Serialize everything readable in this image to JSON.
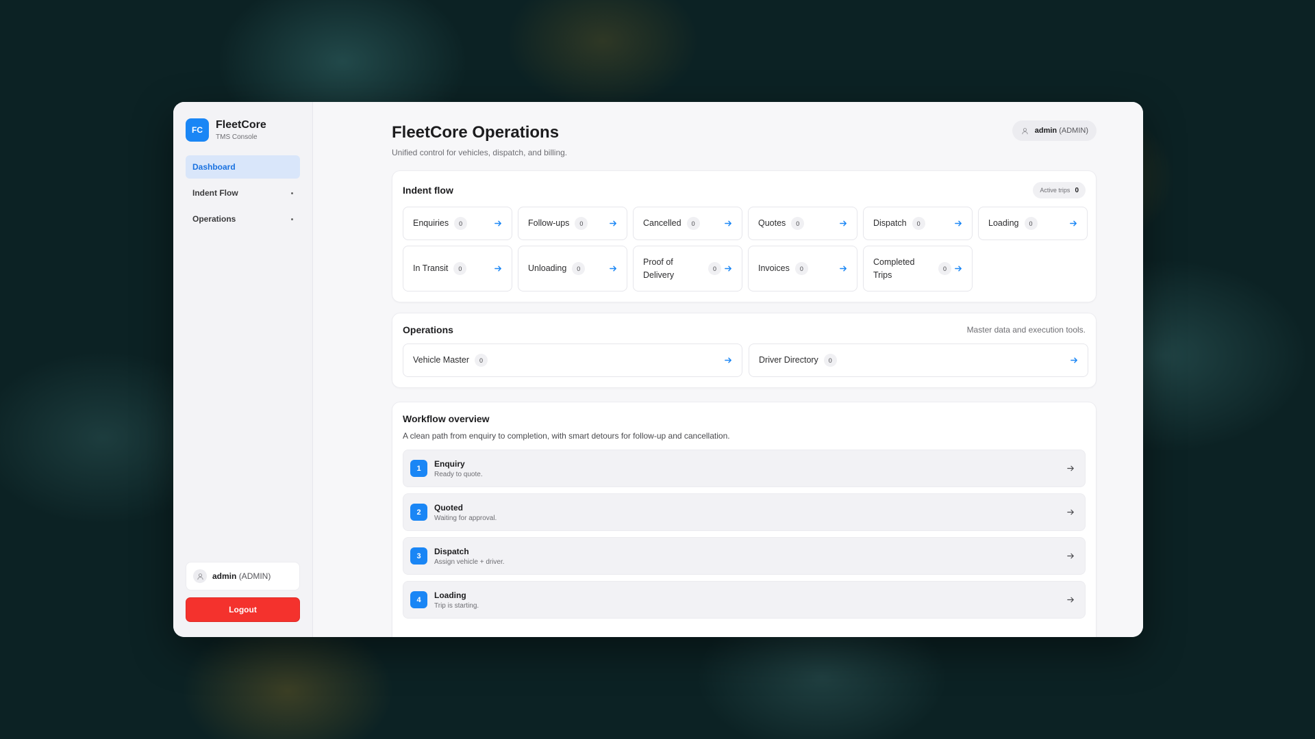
{
  "brand": {
    "logo": "FC",
    "name": "FleetCore",
    "subtitle": "TMS Console"
  },
  "sidebar": {
    "items": [
      {
        "label": "Dashboard",
        "active": true
      },
      {
        "label": "Indent Flow",
        "active": false
      },
      {
        "label": "Operations",
        "active": false
      }
    ],
    "user": {
      "name": "admin",
      "role": "(ADMIN)"
    },
    "logout_label": "Logout"
  },
  "header": {
    "title": "FleetCore Operations",
    "subtitle": "Unified control for vehicles, dispatch, and billing.",
    "user": {
      "name": "admin",
      "role": "(ADMIN)"
    }
  },
  "indent_flow": {
    "title": "Indent flow",
    "active_trips_label": "Active trips",
    "active_trips_count": "0",
    "tiles": [
      {
        "label": "Enquiries",
        "count": "0"
      },
      {
        "label": "Follow-ups",
        "count": "0"
      },
      {
        "label": "Cancelled",
        "count": "0"
      },
      {
        "label": "Quotes",
        "count": "0"
      },
      {
        "label": "Dispatch",
        "count": "0"
      },
      {
        "label": "Loading",
        "count": "0"
      },
      {
        "label": "In Transit",
        "count": "0"
      },
      {
        "label": "Unloading",
        "count": "0"
      },
      {
        "label": "Proof of Delivery",
        "count": "0"
      },
      {
        "label": "Invoices",
        "count": "0"
      },
      {
        "label": "Completed Trips",
        "count": "0"
      }
    ]
  },
  "operations": {
    "title": "Operations",
    "note": "Master data and execution tools.",
    "tiles": [
      {
        "label": "Vehicle Master",
        "count": "0"
      },
      {
        "label": "Driver Directory",
        "count": "0"
      }
    ]
  },
  "workflow": {
    "title": "Workflow overview",
    "description": "A clean path from enquiry to completion, with smart detours for follow-up and cancellation.",
    "steps": [
      {
        "number": "1",
        "title": "Enquiry",
        "subtitle": "Ready to quote."
      },
      {
        "number": "2",
        "title": "Quoted",
        "subtitle": "Waiting for approval."
      },
      {
        "number": "3",
        "title": "Dispatch",
        "subtitle": "Assign vehicle + driver."
      },
      {
        "number": "4",
        "title": "Loading",
        "subtitle": "Trip is starting."
      }
    ]
  },
  "icons": {
    "tile_arrow": "arrow-right-icon",
    "flow_arrow": "arrow-right-icon",
    "user": "user-icon"
  },
  "colors": {
    "accent": "#1a86f5",
    "danger": "#f4322d",
    "active_nav_bg": "#d9e6fa"
  }
}
